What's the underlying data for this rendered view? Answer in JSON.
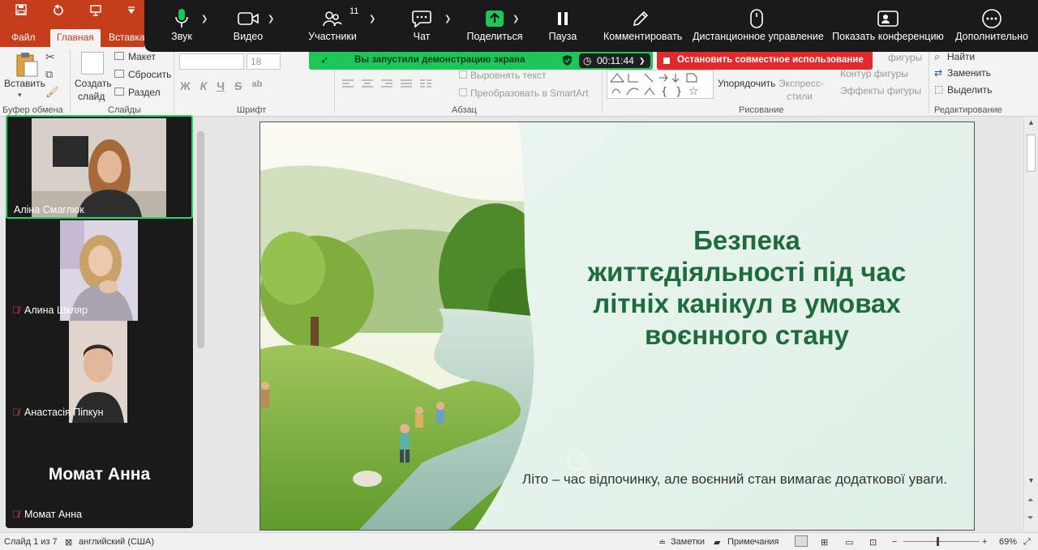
{
  "ppt": {
    "tabs": [
      "Файл",
      "Главная",
      "Вставка"
    ],
    "ribbon": {
      "paste": "Вставить",
      "new_slide": "Создать",
      "new_slide_2": "слайд",
      "layout": "Макет",
      "reset": "Сбросить",
      "section": "Раздел",
      "font_size": "18",
      "align_text": "Выровнять текст",
      "smartart": "Преобразовать в SmartArt",
      "arrange": "Упорядочить",
      "quick_styles": "Экспресс-",
      "quick_styles_2": "стили",
      "shape_fill": "фигуры",
      "shape_outline": "Контур фигуры",
      "shape_effects": "Эффекты фигуры",
      "find": "Найти",
      "replace": "Заменить",
      "select": "Выделить",
      "font_buttons": [
        "Ж",
        "К",
        "Ч",
        "S",
        "ab"
      ]
    },
    "groups": {
      "clipboard": "Буфер обмена",
      "slides": "Слайды",
      "font": "Шрифт",
      "paragraph": "Абзац",
      "drawing": "Рисование",
      "editing": "Редактирование"
    },
    "status": {
      "slide_pos": "Слайд 1 из 7",
      "language": "английский (США)",
      "notes": "Заметки",
      "comments": "Примечания",
      "zoom": "69%"
    }
  },
  "zoom": {
    "toolbar": {
      "audio": "Звук",
      "video": "Видео",
      "participants": "Участники",
      "participants_count": "11",
      "chat": "Чат",
      "share": "Поделиться",
      "pause": "Пауза",
      "annotate": "Комментировать",
      "remote": "Дистанционное управление",
      "show_meeting": "Показать конференцию",
      "more": "Дополнительно"
    },
    "share_banner": "Вы запустили демонстрацию экрана",
    "timer": "00:11:44",
    "stop_share": "Остановить совместное использование",
    "participants": [
      {
        "name": "Аліна Смаглюк"
      },
      {
        "name": "Алина Шкляр"
      },
      {
        "name": "Анастасія Піпкун"
      },
      {
        "name": "Момат Анна",
        "display": "Момат Анна"
      }
    ],
    "colors": {
      "accent": "#1ec659",
      "stop": "#e12b2b",
      "toolbar": "#1a1a1a"
    }
  },
  "slide": {
    "title_lines": [
      "Безпека",
      "життєдіяльності під час",
      "літніх канікул в умовах",
      "воєнного стану"
    ],
    "subtitle": "Літо – час відпочинку, але воєнний стан вимагає додаткової уваги.",
    "title_color": "#1f6b3e"
  }
}
